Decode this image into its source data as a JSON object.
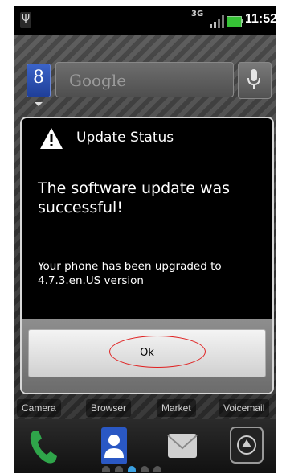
{
  "status_bar": {
    "network": "3G",
    "time": "11:52",
    "usb_icon": "usb-debug-icon",
    "battery_color": "#36c336"
  },
  "search": {
    "placeholder": "Google"
  },
  "dialog": {
    "title": "Update Status",
    "message": "The software update was successful!",
    "detail": "Your phone has been upgraded to 4.7.3.en.US version",
    "ok_label": "Ok",
    "highlight_color": "#e02020"
  },
  "dock": {
    "labels": [
      "Camera",
      "Browser",
      "Market",
      "Voicemail"
    ]
  }
}
